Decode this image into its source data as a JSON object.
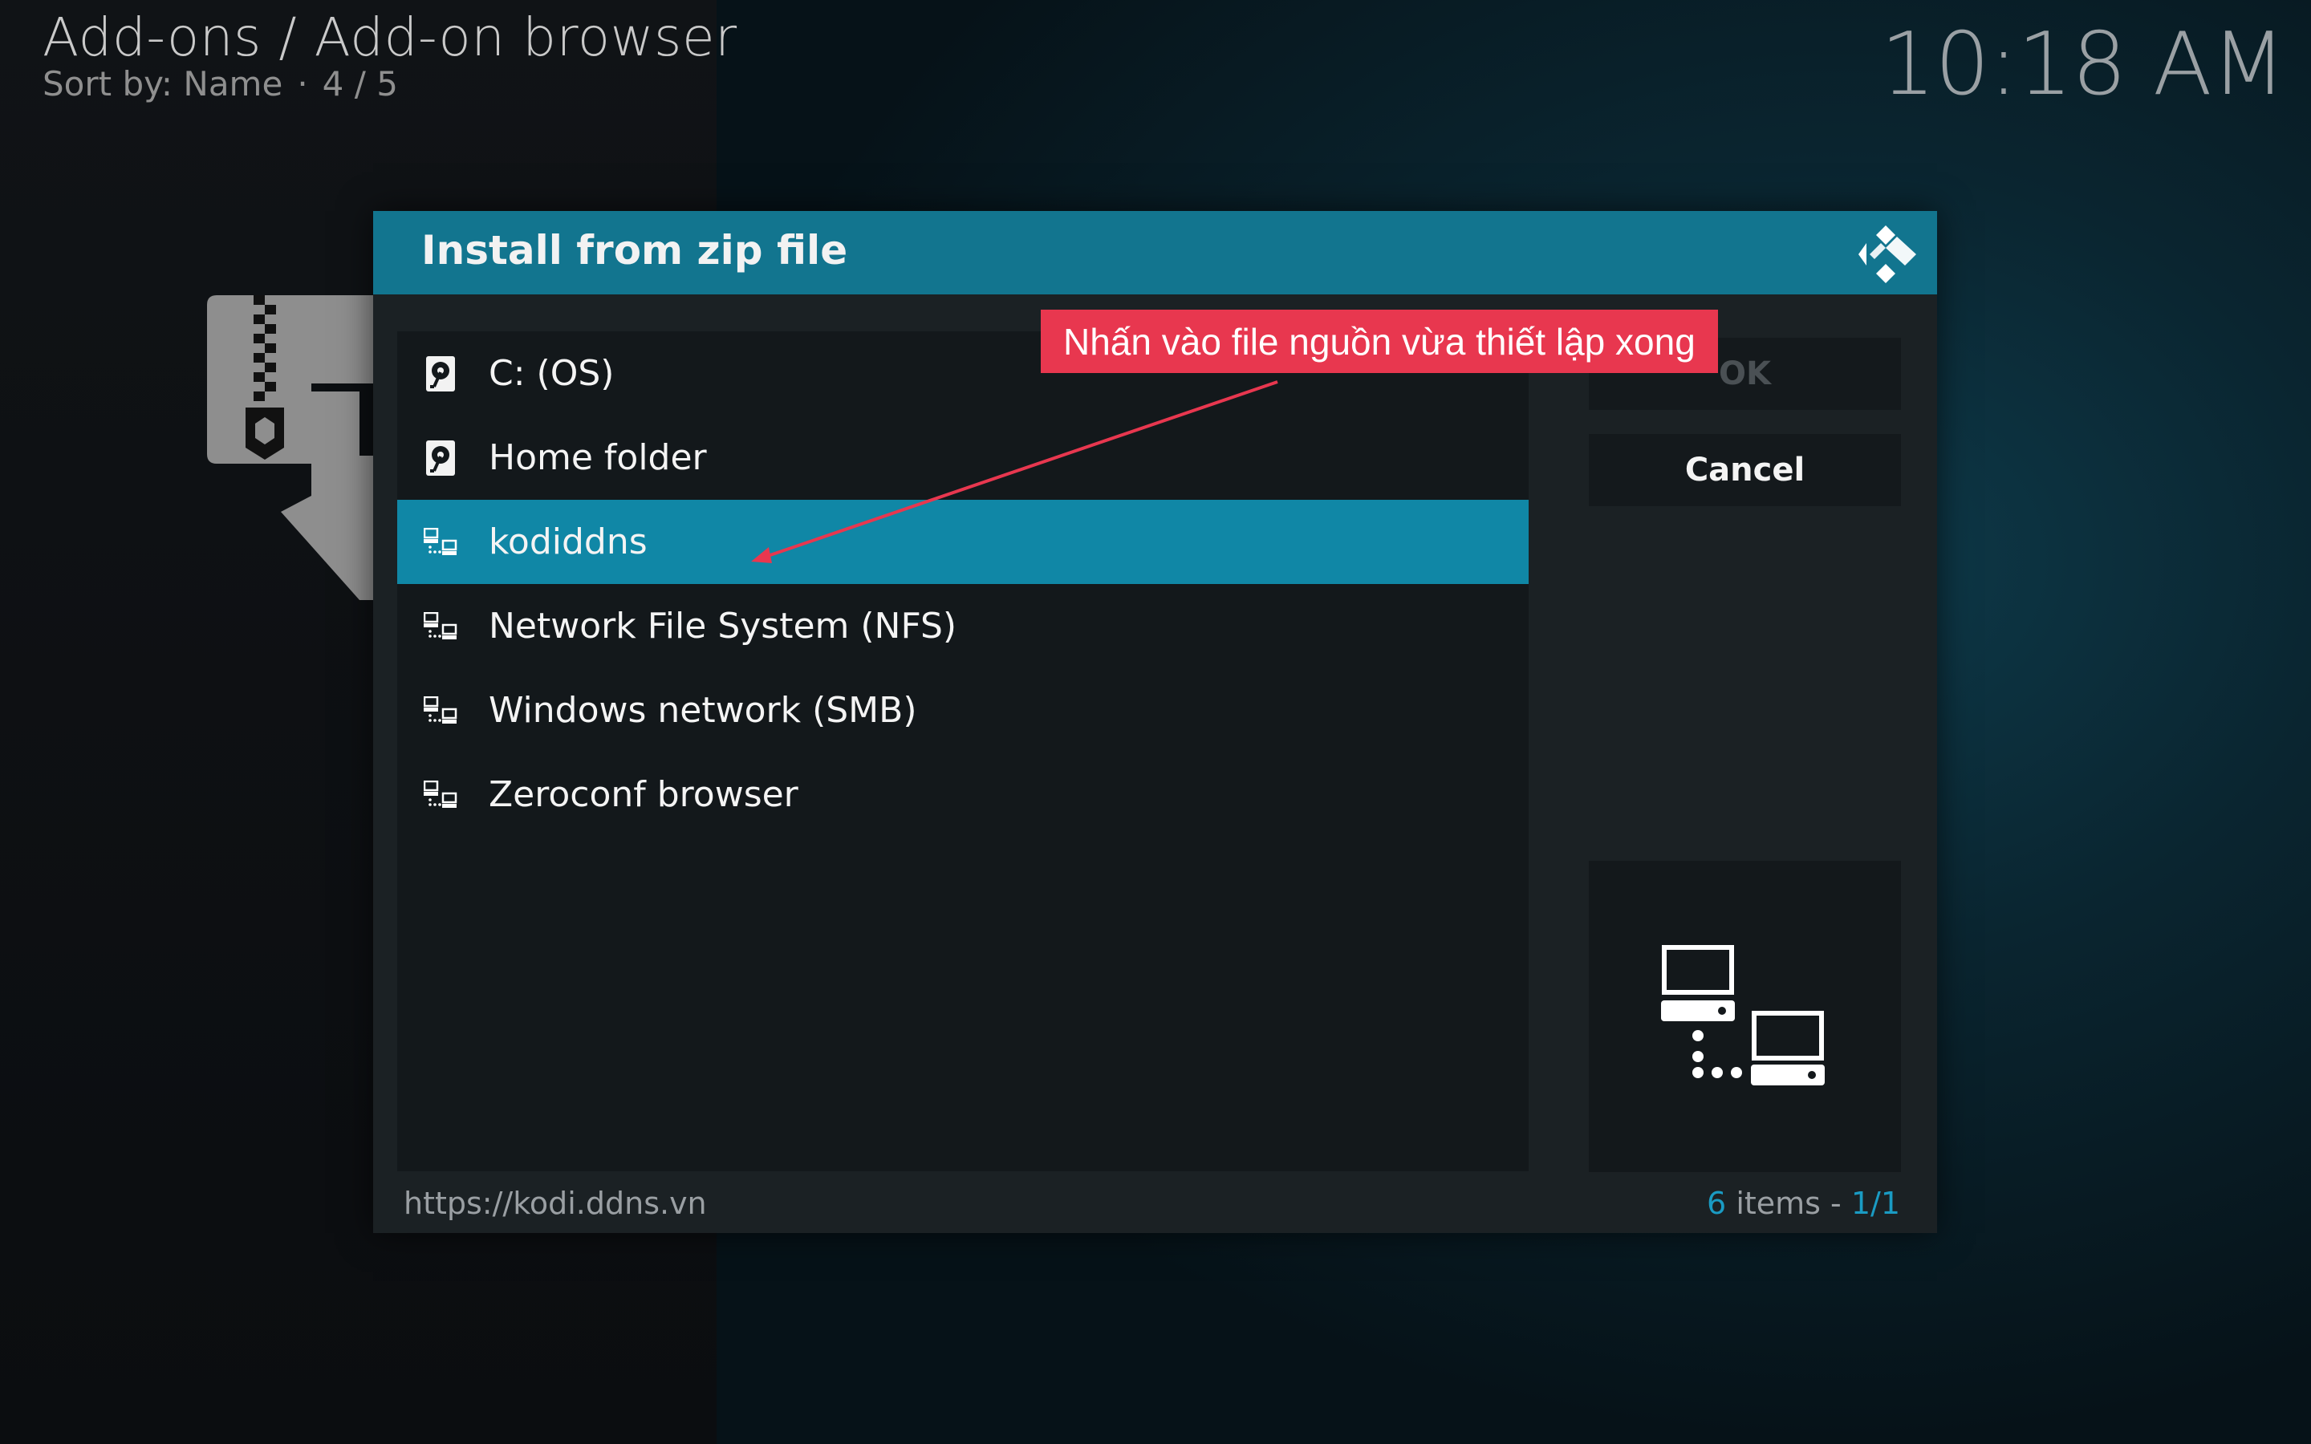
{
  "header": {
    "breadcrumb": "Add-ons / Add-on browser",
    "sort_label": "Sort by: Name",
    "separator": "·",
    "position": "4 / 5"
  },
  "clock": "10:18 AM",
  "dialog": {
    "title": "Install from zip file",
    "items": [
      {
        "label": "C: (OS)",
        "icon": "hard-drive-icon",
        "selected": false
      },
      {
        "label": "Home folder",
        "icon": "hard-drive-icon",
        "selected": false
      },
      {
        "label": "kodiddns",
        "icon": "network-icon",
        "selected": true
      },
      {
        "label": "Network File System (NFS)",
        "icon": "network-icon",
        "selected": false
      },
      {
        "label": "Windows network (SMB)",
        "icon": "network-icon",
        "selected": false
      },
      {
        "label": "Zeroconf browser",
        "icon": "network-icon",
        "selected": false
      }
    ],
    "ok_label": "OK",
    "cancel_label": "Cancel",
    "footer_path": "https://kodi.ddns.vn",
    "item_count": "6",
    "items_word": " items - ",
    "page": "1/1"
  },
  "annotation": {
    "text": "Nhấn vào file nguồn vừa thiết lập xong",
    "color": "#e8374f"
  },
  "colors": {
    "accent": "#12758f",
    "selected": "#1087a6",
    "highlight_text": "#1a9bc3"
  }
}
